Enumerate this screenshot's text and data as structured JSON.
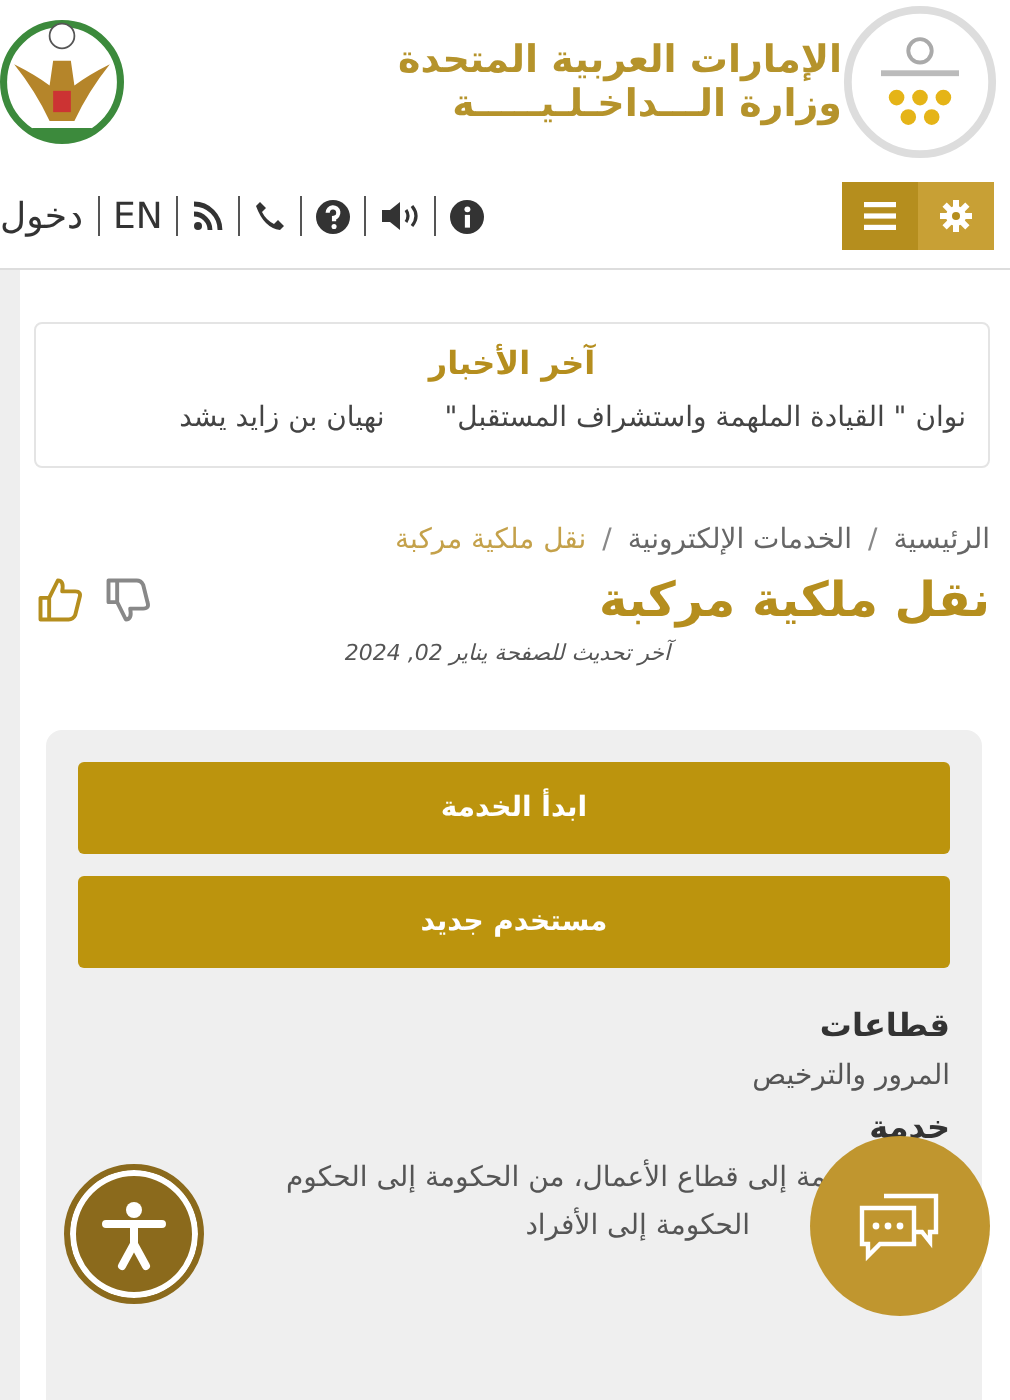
{
  "header": {
    "title_line_1": "الإمارات العربية المتحدة",
    "title_line_2": "وزارة الـــداخـلـيـــــة"
  },
  "toolbar": {
    "login": "دخول",
    "language": "EN"
  },
  "news": {
    "title": "آخر الأخبار",
    "ticker": [
      "نوان \" القيادة الملهمة واستشراف المستقبل\"",
      "نهيان بن زايد يشد"
    ]
  },
  "breadcrumb": {
    "separator": "/",
    "items": [
      {
        "label": "الرئيسية",
        "current": false
      },
      {
        "label": "الخدمات الإلكترونية",
        "current": false
      },
      {
        "label": "نقل ملكية مركبة",
        "current": true
      }
    ]
  },
  "page": {
    "title": "نقل ملكية مركبة",
    "updated": "آخر تحديث للصفحة يناير 02, 2024"
  },
  "actions": [
    "ابدأ الخدمة",
    "مستخدم جديد"
  ],
  "details": [
    {
      "kind": "heading",
      "text": "قطاعات"
    },
    {
      "kind": "text",
      "text": "المرور والترخيص"
    },
    {
      "kind": "heading",
      "text": "خدمة"
    },
    {
      "kind": "text",
      "text": "مة إلى قطاع الأعمال، من الحكومة إلى الحكوم"
    },
    {
      "kind": "text",
      "text": "الحكومة إلى الأفراد"
    }
  ]
}
